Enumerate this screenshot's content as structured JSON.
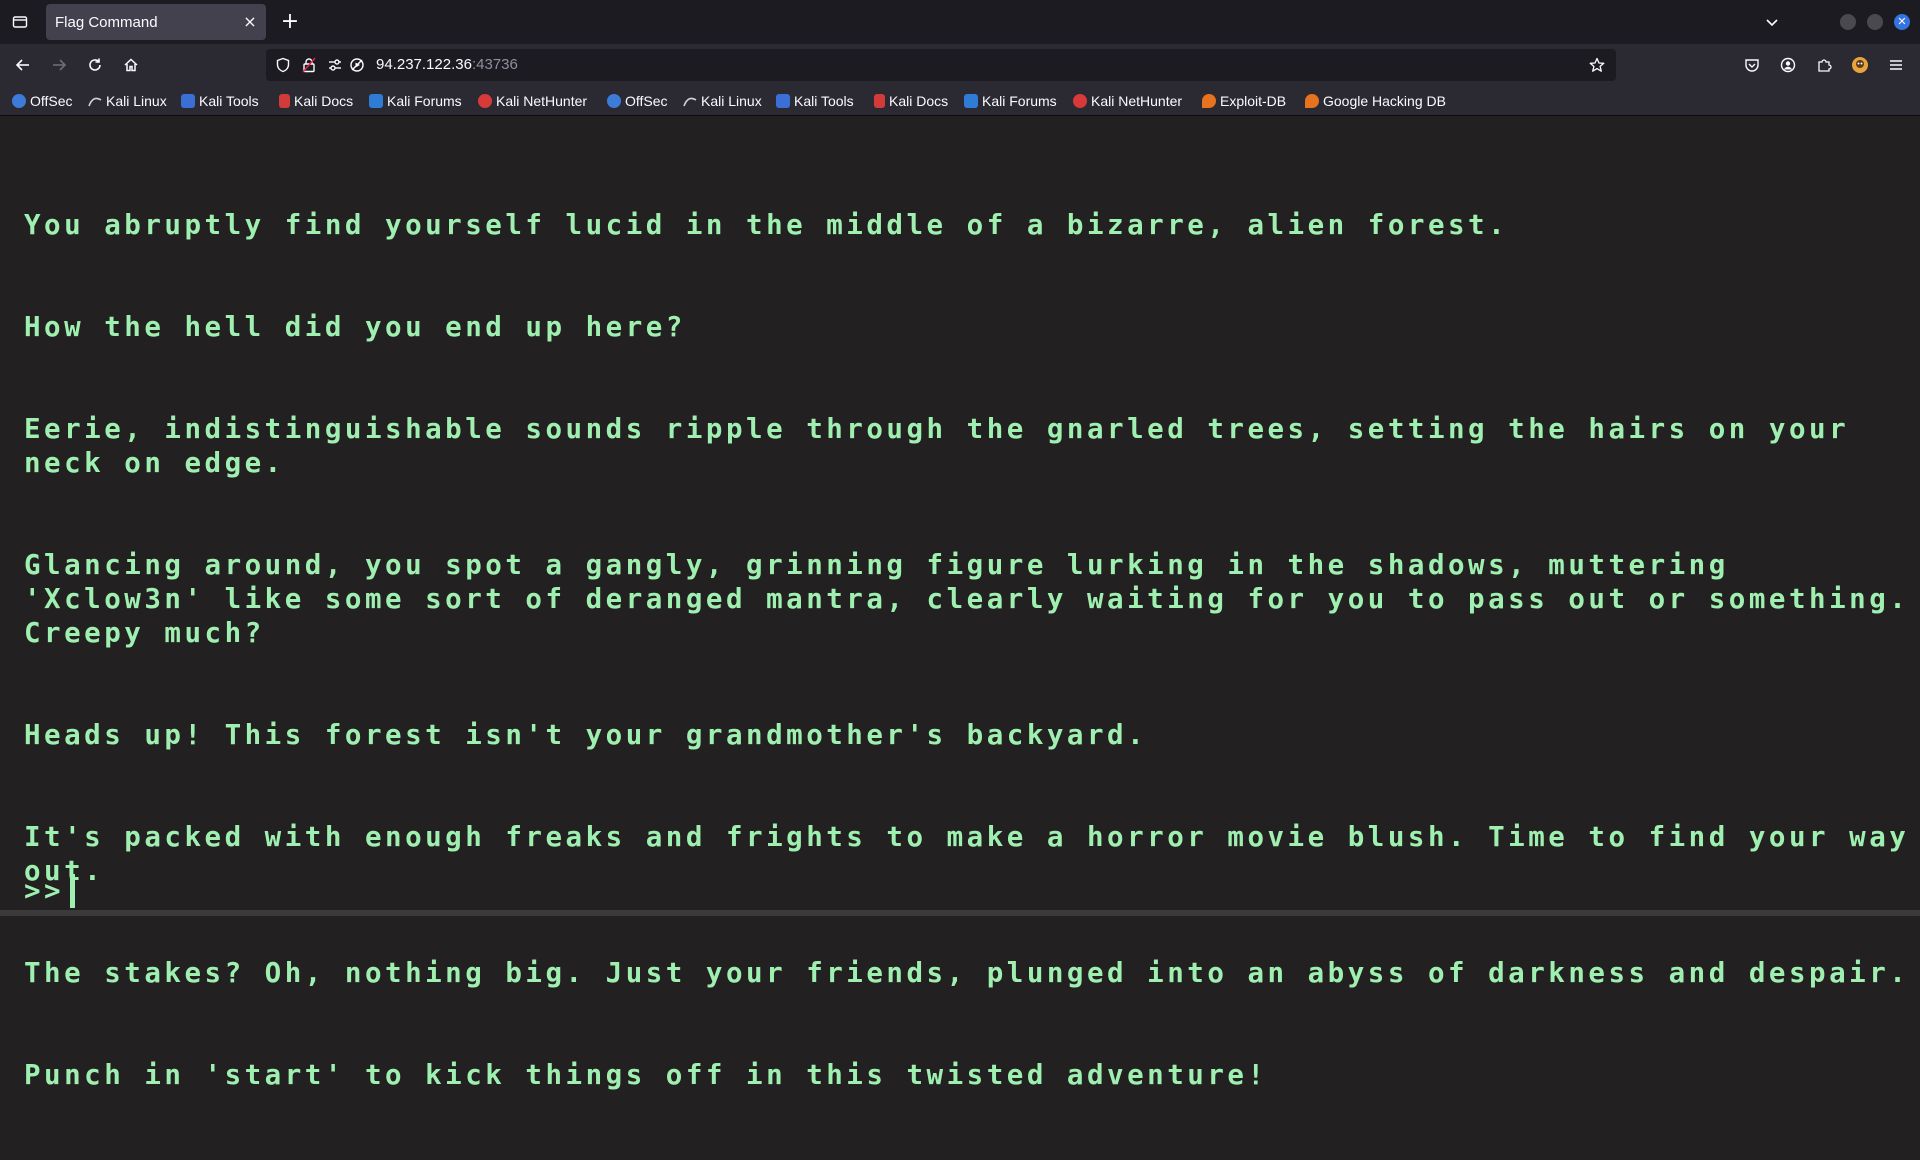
{
  "browser": {
    "tab": {
      "title": "Flag Command",
      "close_glyph": "×"
    },
    "new_tab_glyph": "+",
    "url": {
      "host": "94.237.122.36",
      "port": ":43736"
    }
  },
  "bookmarks": [
    {
      "label": "OffSec",
      "icon": "offsec-icon",
      "color": "#3d7bd8"
    },
    {
      "label": "Kali Linux",
      "icon": "kali-dragon-icon",
      "color": "#cfd3dc"
    },
    {
      "label": "Kali Tools",
      "icon": "kali-tools-icon",
      "color": "#3b6fd6"
    },
    {
      "label": "Kali Docs",
      "icon": "kali-docs-icon",
      "color": "#d33a3a"
    },
    {
      "label": "Kali Forums",
      "icon": "kali-forums-icon",
      "color": "#2e7cd6"
    },
    {
      "label": "Kali NetHunter",
      "icon": "kali-nethunter-icon",
      "color": "#d83a3a"
    },
    {
      "label": "OffSec",
      "icon": "offsec-icon",
      "color": "#3d7bd8"
    },
    {
      "label": "Kali Linux",
      "icon": "kali-dragon-icon",
      "color": "#cfd3dc"
    },
    {
      "label": "Kali Tools",
      "icon": "kali-tools-icon",
      "color": "#3b6fd6"
    },
    {
      "label": "Kali Docs",
      "icon": "kali-docs-icon",
      "color": "#d33a3a"
    },
    {
      "label": "Kali Forums",
      "icon": "kali-forums-icon",
      "color": "#2e7cd6"
    },
    {
      "label": "Kali NetHunter",
      "icon": "kali-nethunter-icon",
      "color": "#d83a3a"
    },
    {
      "label": "Exploit-DB",
      "icon": "exploit-db-icon",
      "color": "#e8731e"
    },
    {
      "label": "Google Hacking DB",
      "icon": "google-hacking-db-icon",
      "color": "#e8731e"
    }
  ],
  "terminal": {
    "lines": [
      "You abruptly find yourself lucid in the middle of a bizarre, alien forest.",
      "How the hell did you end up here?",
      "Eerie, indistinguishable sounds ripple through the gnarled trees, setting the hairs on your neck on edge.",
      "Glancing around, you spot a gangly, grinning figure lurking in the shadows, muttering 'Xclow3n' like some sort of deranged mantra, clearly waiting for you to pass out or something. Creepy much?",
      "Heads up! This forest isn't your grandmother's backyard.",
      "It's packed with enough freaks and frights to make a horror movie blush. Time to find your way out.",
      "The stakes? Oh, nothing big. Just your friends, plunged into an abyss of darkness and despair.",
      "Punch in 'start' to kick things off in this twisted adventure!"
    ],
    "prompt": ">>",
    "input_value": ""
  },
  "colors": {
    "terminal_text": "#9ff0b0",
    "terminal_bg": "#222020",
    "accent": "#3574e0"
  }
}
